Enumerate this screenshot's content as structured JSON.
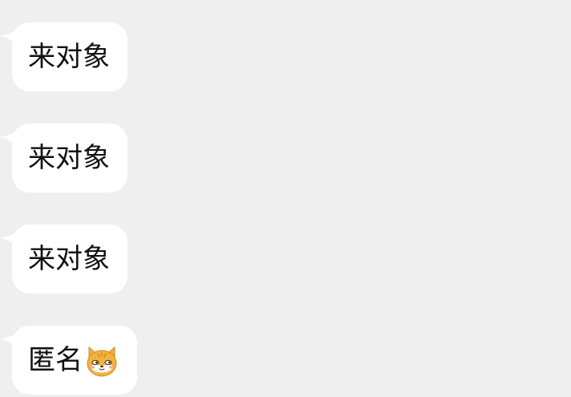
{
  "messages": [
    {
      "text": "来对象",
      "has_emoji": false
    },
    {
      "text": "来对象",
      "has_emoji": false
    },
    {
      "text": "来对象",
      "has_emoji": false
    },
    {
      "text": "匿名",
      "has_emoji": true,
      "emoji": "shiba-dog-face-icon"
    }
  ],
  "colors": {
    "background": "#efefef",
    "bubble": "#ffffff",
    "text": "#111111",
    "emoji_fur": "#f2b33d",
    "emoji_face": "#ffffff"
  }
}
